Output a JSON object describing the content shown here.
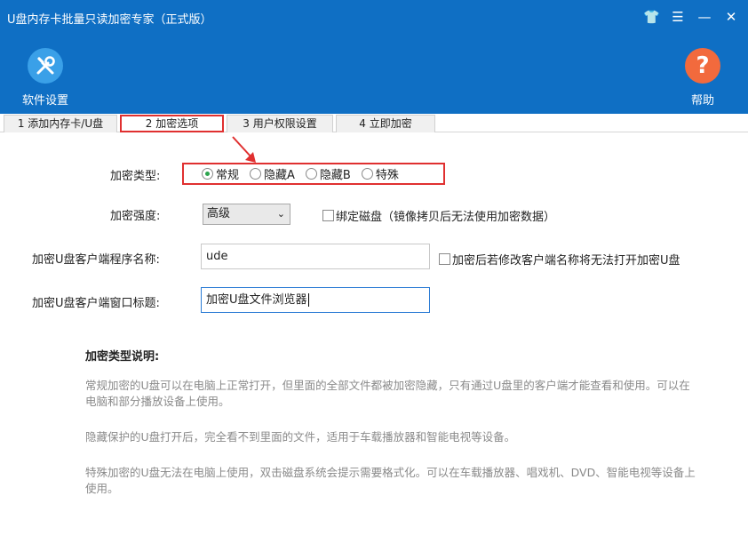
{
  "window": {
    "title": "U盘内存卡批量只读加密专家（正式版）",
    "controls": {
      "skin": "👕",
      "menu": "☰",
      "minimize": "—",
      "close": "✕"
    }
  },
  "toolbar": {
    "settings": {
      "label": "软件设置",
      "icon": "wrench-screwdriver-icon"
    },
    "help": {
      "label": "帮助",
      "icon": "question-mark-icon",
      "glyph": "?"
    }
  },
  "tabs": [
    {
      "label": "1 添加内存卡/U盘"
    },
    {
      "label": "2 加密选项",
      "active": true
    },
    {
      "label": "3 用户权限设置"
    },
    {
      "label": "4 立即加密"
    }
  ],
  "form": {
    "encrypt_type": {
      "label": "加密类型:",
      "options": [
        "常规",
        "隐藏A",
        "隐藏B",
        "特殊"
      ],
      "selected": "常规"
    },
    "strength": {
      "label": "加密强度:",
      "value": "高级",
      "chevron": "⌄"
    },
    "bind_disk": {
      "label": "绑定磁盘（镜像拷贝后无法使用加密数据）",
      "checked": false
    },
    "client_name": {
      "label": "加密U盘客户端程序名称:",
      "value": "ude"
    },
    "rename_warning": {
      "label": "加密后若修改客户端名称将无法打开加密U盘",
      "checked": false
    },
    "window_title": {
      "label": "加密U盘客户端窗口标题:",
      "value": "加密U盘文件浏览器"
    }
  },
  "description": {
    "title": "加密类型说明:",
    "paragraphs": [
      "常规加密的U盘可以在电脑上正常打开，但里面的全部文件都被加密隐藏，只有通过U盘里的客户端才能查看和使用。可以在电脑和部分播放设备上使用。",
      "隐藏保护的U盘打开后，完全看不到里面的文件，适用于车载播放器和智能电视等设备。",
      "特殊加密的U盘无法在电脑上使用，双击磁盘系统会提示需要格式化。可以在车载播放器、唱戏机、DVD、智能电视等设备上使用。"
    ]
  },
  "colors": {
    "header": "#0f6fc4",
    "highlight": "#e03030",
    "radio_on": "#2da44e",
    "help": "#f26a3d",
    "settings": "#3aa0e8"
  }
}
